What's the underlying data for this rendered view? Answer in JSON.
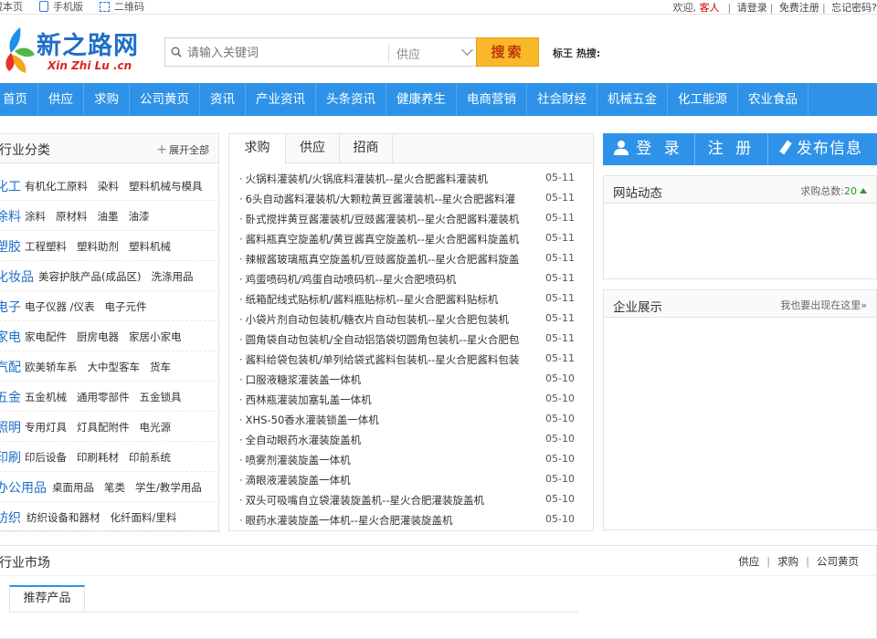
{
  "topbar": {
    "bookmark": "藏本页",
    "mobile": "手机版",
    "qrcode": "二维码",
    "welcome": "欢迎,",
    "guest": "客人",
    "login": "请登录",
    "register": "免费注册",
    "forgot": "忘记密码?",
    "sep": "|"
  },
  "logo": {
    "cn": "新之路网",
    "en": "Xin Zhi Lu .cn"
  },
  "search": {
    "placeholder": "请输入关键词",
    "select_value": "供应",
    "button": "搜索",
    "hot_label": "标王 热搜:"
  },
  "nav": [
    "首页",
    "供应",
    "求购",
    "公司黄页",
    "资讯",
    "产业资讯",
    "头条资讯",
    "健康养生",
    "电商营销",
    "社会财经",
    "机械五金",
    "化工能源",
    "农业食品"
  ],
  "categories": {
    "title": "行业分类",
    "expand": "展开全部",
    "items": [
      {
        "main": "化工",
        "subs": [
          "有机化工原料",
          "染料",
          "塑料机械与模具"
        ]
      },
      {
        "main": "涂料",
        "subs": [
          "涂料",
          "原材料",
          "油墨",
          "油漆"
        ]
      },
      {
        "main": "塑胶",
        "subs": [
          "工程塑料",
          "塑料助剂",
          "塑料机械"
        ]
      },
      {
        "main": "化妆品",
        "subs": [
          "美容护肤产品(成品区)",
          "洗涤用品"
        ]
      },
      {
        "main": "电子",
        "subs": [
          "电子仪器 /仪表",
          "电子元件"
        ]
      },
      {
        "main": "家电",
        "subs": [
          "家电配件",
          "厨房电器",
          "家居小家电"
        ]
      },
      {
        "main": "汽配",
        "subs": [
          "欧美轿车系",
          "大中型客车",
          "货车"
        ]
      },
      {
        "main": "五金",
        "subs": [
          "五金机械",
          "通用零部件",
          "五金锁具"
        ]
      },
      {
        "main": "照明",
        "subs": [
          "专用灯具",
          "灯具配附件",
          "电光源"
        ]
      },
      {
        "main": "印刷",
        "subs": [
          "印后设备",
          "印刷耗材",
          "印前系统"
        ]
      },
      {
        "main": "办公用品",
        "subs": [
          "桌面用品",
          "笔类",
          "学生/教学用品"
        ]
      },
      {
        "main": "纺织",
        "subs": [
          "纺织设备和器材",
          "化纤面料/里料"
        ]
      }
    ]
  },
  "middle": {
    "tabs": [
      "求购",
      "供应",
      "招商"
    ],
    "news": [
      {
        "title": "火锅料灌装机/火锅底料灌装机--星火合肥酱料灌装机",
        "date": "05-11"
      },
      {
        "title": "6头自动酱料灌装机/大颗粒黄豆酱灌装机--星火合肥酱料灌",
        "date": "05-11"
      },
      {
        "title": "卧式搅拌黄豆酱灌装机/豆豉酱灌装机--星火合肥酱料灌装机",
        "date": "05-11"
      },
      {
        "title": "酱料瓶真空旋盖机/黄豆酱真空旋盖机--星火合肥酱料旋盖机",
        "date": "05-11"
      },
      {
        "title": "辣椒酱玻璃瓶真空旋盖机/豆豉酱旋盖机--星火合肥酱料旋盖",
        "date": "05-11"
      },
      {
        "title": "鸡蛋喷码机/鸡蛋自动喷码机--星火合肥喷码机",
        "date": "05-11"
      },
      {
        "title": "纸箱配线式贴标机/酱料瓶贴标机--星火合肥酱料贴标机",
        "date": "05-11"
      },
      {
        "title": "小袋片剂自动包装机/糖衣片自动包装机--星火合肥包装机",
        "date": "05-11"
      },
      {
        "title": "圆角袋自动包装机/全自动铝箔袋切圆角包装机--星火合肥包",
        "date": "05-11"
      },
      {
        "title": "酱料给袋包装机/单列给袋式酱料包装机--星火合肥酱料包装",
        "date": "05-11"
      },
      {
        "title": "口服液糖浆灌装盖一体机",
        "date": "05-10"
      },
      {
        "title": "西林瓶灌装加塞轧盖一体机",
        "date": "05-10"
      },
      {
        "title": "XHS-50香水灌装锁盖一体机",
        "date": "05-10"
      },
      {
        "title": "全自动眼药水灌装旋盖机",
        "date": "05-10"
      },
      {
        "title": "喷雾剂灌装旋盖一体机",
        "date": "05-10"
      },
      {
        "title": "滴眼液灌装旋盖一体机",
        "date": "05-10"
      },
      {
        "title": "双头可吸嘴自立袋灌装旋盖机--星火合肥灌装旋盖机",
        "date": "05-10"
      },
      {
        "title": "眼药水灌装旋盖一体机--星火合肥灌装旋盖机",
        "date": "05-10"
      }
    ]
  },
  "auth": {
    "login": "登 录",
    "register": "注 册",
    "post": "发布信息"
  },
  "site_news": {
    "title": "网站动态",
    "count_label": "求购总数:",
    "count": "20"
  },
  "company_show": {
    "title": "企业展示",
    "link": "我也要出现在这里»"
  },
  "market": {
    "title": "行业市场",
    "links": [
      "供应",
      "求购",
      "公司黄页"
    ],
    "subtab": "推荐产品"
  },
  "colors": {
    "nav_blue": "#2e93e8",
    "search_button": "#f8b82a",
    "category_blue": "#1f6fc8",
    "guest_red": "#cc0000"
  }
}
